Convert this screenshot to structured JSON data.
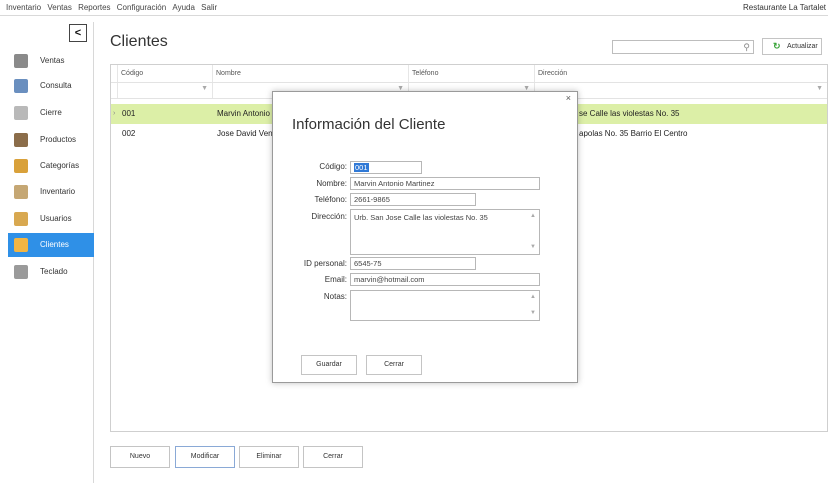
{
  "menu": {
    "items": [
      "Inventario",
      "Ventas",
      "Reportes",
      "Configuración",
      "Ayuda",
      "Salir"
    ],
    "app_name": "Restaurante La Tartalet"
  },
  "sidebar": {
    "collapse_glyph": "<",
    "items": [
      {
        "label": "Ventas",
        "icon": "cash-register-icon",
        "color": "#8a8a8a"
      },
      {
        "label": "Consulta",
        "icon": "monitor-icon",
        "color": "#6a8fbf"
      },
      {
        "label": "Cierre",
        "icon": "receipt-icon",
        "color": "#b9b9b9"
      },
      {
        "label": "Productos",
        "icon": "coffee-cup-icon",
        "color": "#8b6d4a"
      },
      {
        "label": "Categorías",
        "icon": "food-icon",
        "color": "#d9a13a"
      },
      {
        "label": "Inventario",
        "icon": "clipboard-icon",
        "color": "#c5a774"
      },
      {
        "label": "Usuarios",
        "icon": "users-icon",
        "color": "#d8a850"
      },
      {
        "label": "Clientes",
        "icon": "client-icon",
        "color": "#f2b544",
        "active": true
      },
      {
        "label": "Teclado",
        "icon": "keyboard-icon",
        "color": "#9a9a9a"
      }
    ]
  },
  "page": {
    "title": "Clientes",
    "search_placeholder": "",
    "search_icon": "⚲",
    "refresh_icon": "↻",
    "refresh_label": "Actualizar"
  },
  "grid": {
    "columns": [
      "Código",
      "Nombre",
      "Teléfono",
      "Dirección"
    ],
    "filter_icon": "▼",
    "row_indicator": "›",
    "rows": [
      {
        "code": "001",
        "name": "Marvin Antonio",
        "phone": "",
        "address": "se Calle las violestas No. 35",
        "selected": true
      },
      {
        "code": "002",
        "name": "Jose David Venta",
        "phone": "",
        "address": "apolas No. 35 Barrio El Centro",
        "selected": false
      }
    ]
  },
  "actions": {
    "new": "Nuevo",
    "edit": "Modificar",
    "delete": "Eliminar",
    "close": "Cerrar"
  },
  "dialog": {
    "title": "Información del Cliente",
    "close_glyph": "×",
    "labels": {
      "code": "Código:",
      "name": "Nombre:",
      "phone": "Teléfono:",
      "address": "Dirección:",
      "personal_id": "ID personal:",
      "email": "Email:",
      "notes": "Notas:"
    },
    "values": {
      "code": "001",
      "name": "Marvin Antonio Martinez",
      "phone": "2661-9865",
      "address": "Urb. San Jose Calle las violestas No. 35",
      "personal_id": "6545-75",
      "email": "marvin@hotmail.com",
      "notes": ""
    },
    "buttons": {
      "save": "Guardar",
      "close": "Cerrar"
    }
  },
  "colors": {
    "accent": "#2f90e7",
    "selected_row": "#dcefa7",
    "refresh_green": "#3aa43a"
  }
}
